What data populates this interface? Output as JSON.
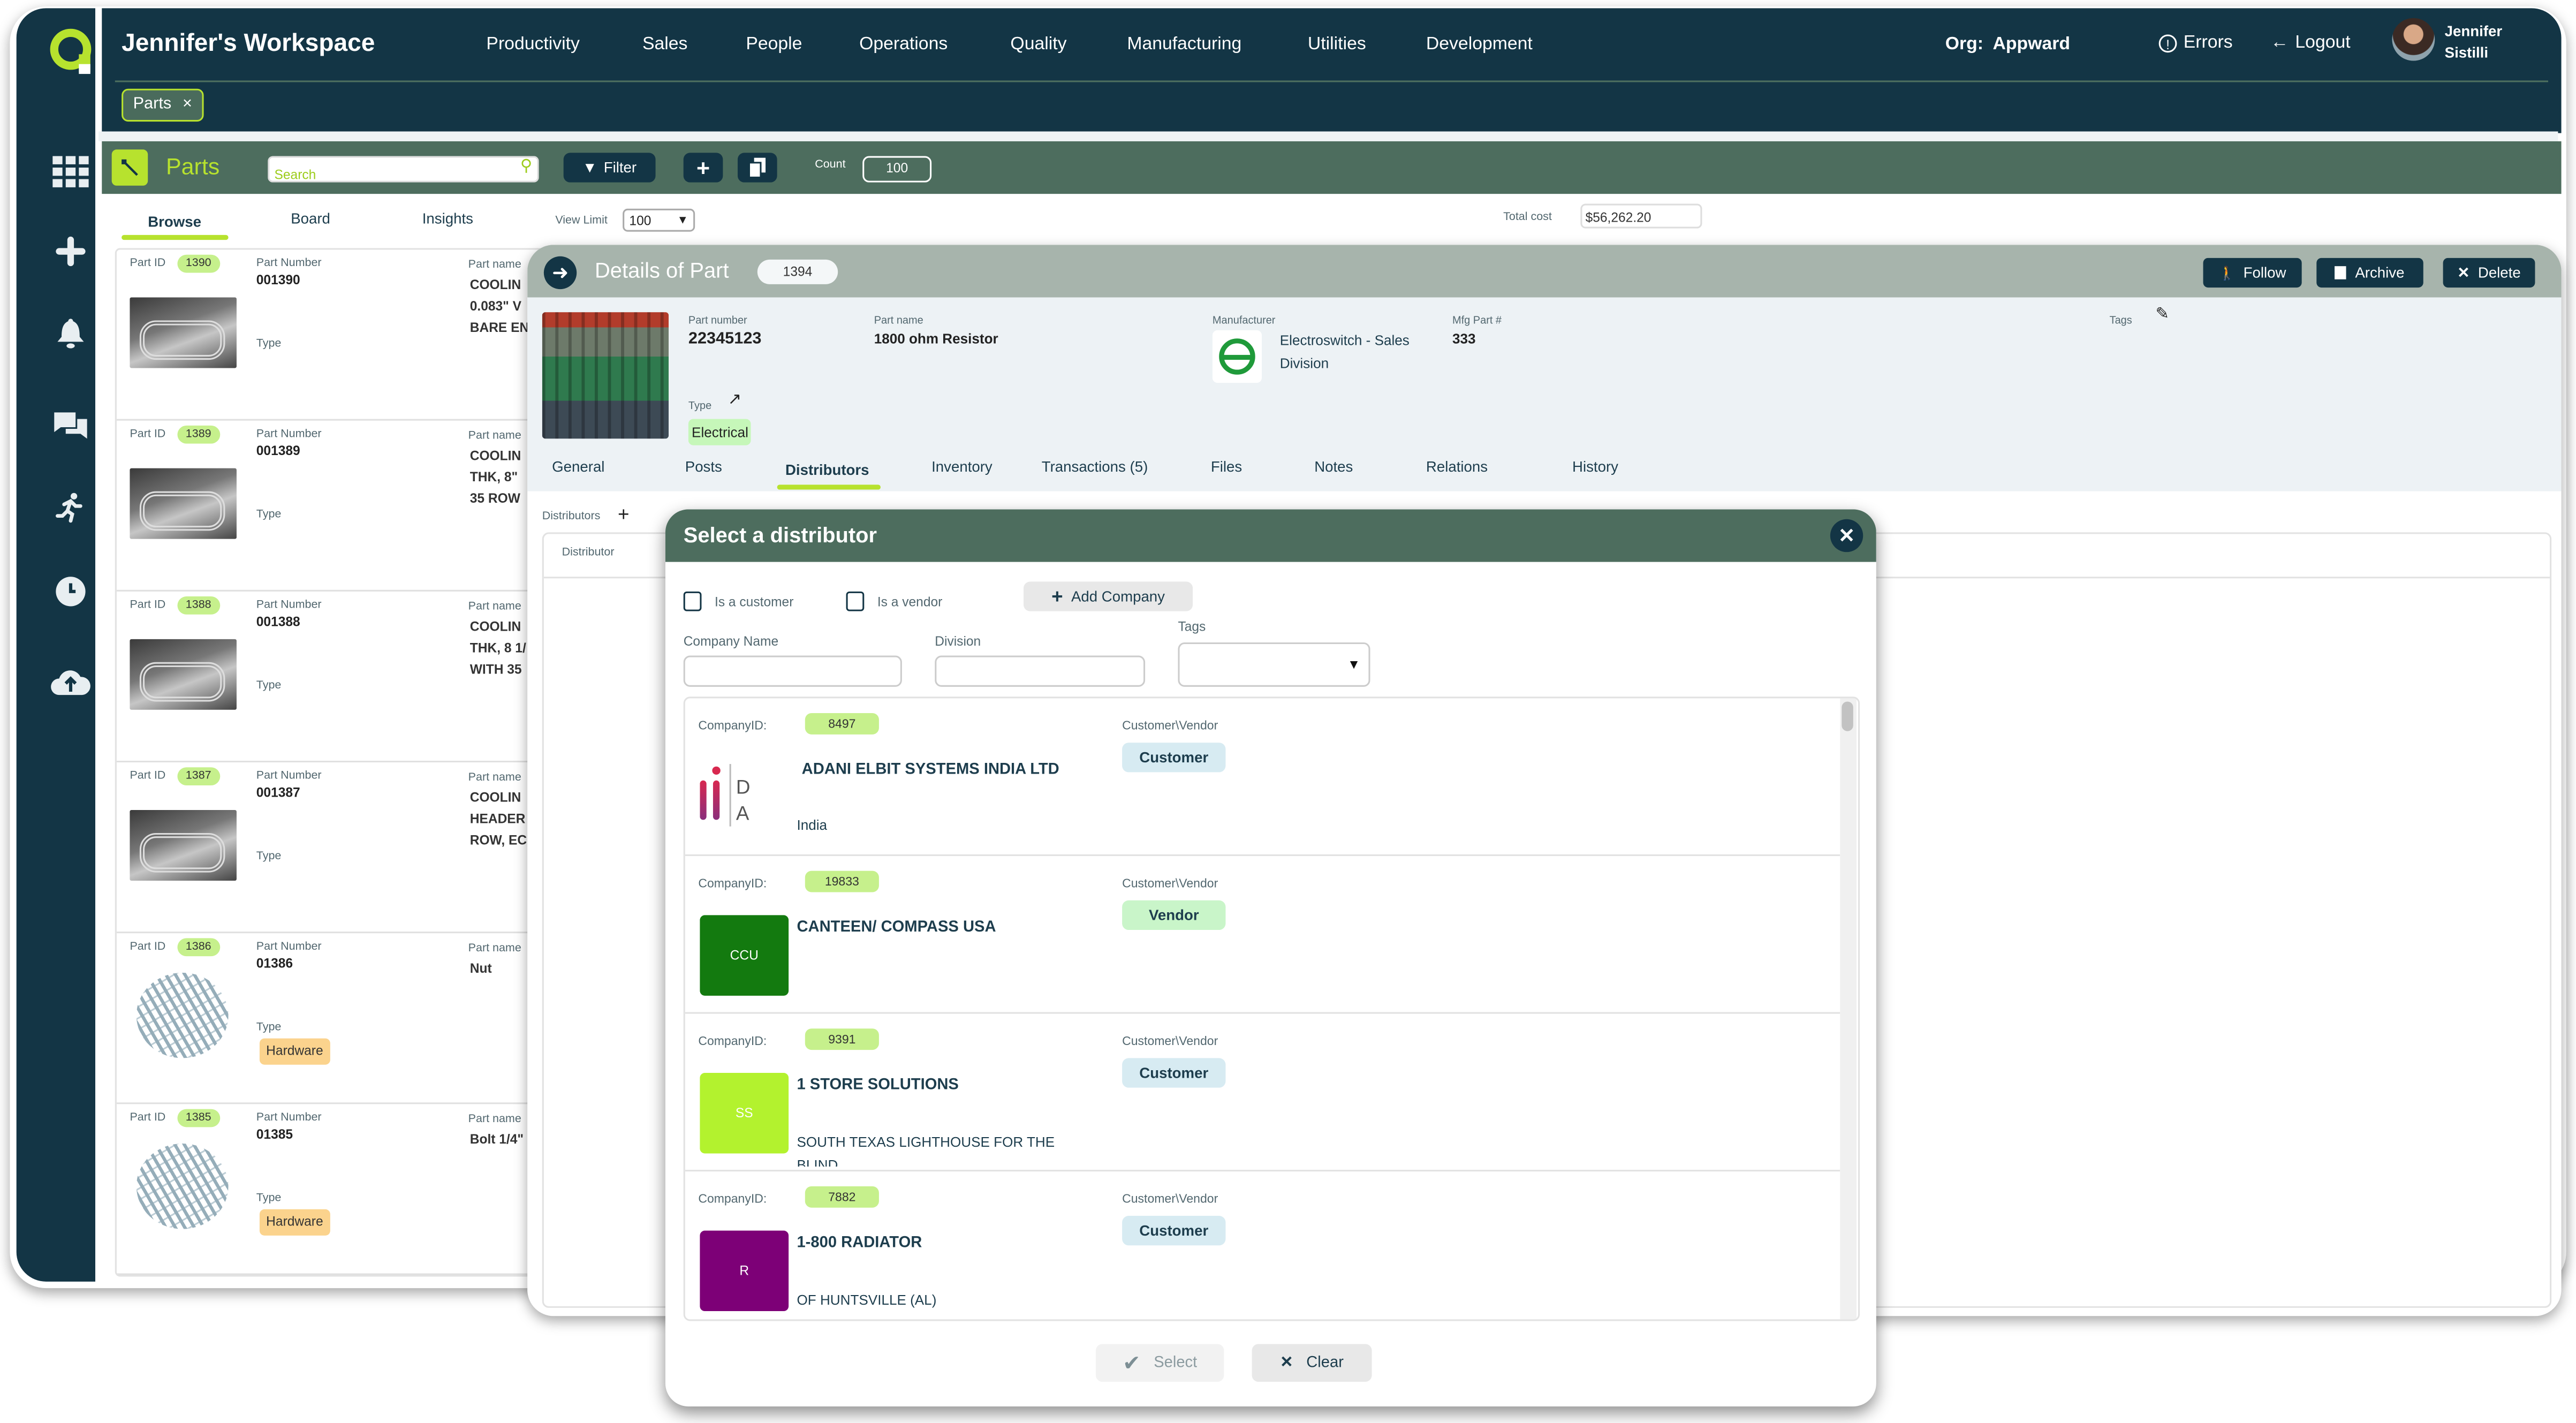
{
  "app": {
    "workspace_title": "Jennifer's Workspace",
    "nav": [
      "Productivity",
      "Sales",
      "People",
      "Operations",
      "Quality",
      "Manufacturing",
      "Utilities",
      "Development"
    ],
    "org_label": "Org:",
    "org_name": "Appward",
    "errors_label": "Errors",
    "logout_label": "Logout",
    "user_first": "Jennifer",
    "user_last": "Sistilli",
    "open_tab": "Parts",
    "open_tab_close": "×",
    "colors": {
      "navy": "#133545",
      "green_bar": "#4d6d5e",
      "accent": "#b7e22e"
    }
  },
  "sidebar": {
    "icons": [
      "apps-grid-icon",
      "plus-icon",
      "bell-icon",
      "chat-icon",
      "running-icon",
      "clock-icon",
      "cloud-upload-icon"
    ]
  },
  "parts_bar": {
    "title": "Parts",
    "search_placeholder": "Search",
    "filter_label": "Filter",
    "count_label": "Count",
    "count_value": "100"
  },
  "list": {
    "tabs": [
      "Browse",
      "Board",
      "Insights"
    ],
    "active_tab": "Browse",
    "view_limit_label": "View Limit",
    "view_limit_value": "100",
    "total_cost_label": "Total cost",
    "total_cost_value": "$56,262.20",
    "labels": {
      "part_id": "Part ID",
      "part_number": "Part Number",
      "part_name": "Part name",
      "type": "Type"
    },
    "rows": [
      {
        "id": "1390",
        "number": "001390",
        "name": [
          "COOLIN",
          "0.083\" V",
          "BARE EN"
        ],
        "type": "",
        "thumb": "coil"
      },
      {
        "id": "1389",
        "number": "001389",
        "name": [
          "COOLIN",
          "THK, 8\"",
          "35 ROW"
        ],
        "type": "",
        "thumb": "coil"
      },
      {
        "id": "1388",
        "number": "001388",
        "name": [
          "COOLIN",
          "THK, 8 1/",
          "WITH 35"
        ],
        "type": "",
        "thumb": "coil"
      },
      {
        "id": "1387",
        "number": "001387",
        "name": [
          "COOLIN",
          "HEADER",
          "ROW, EC"
        ],
        "type": "",
        "thumb": "coil"
      },
      {
        "id": "1386",
        "number": "01386",
        "name": [
          "Nut"
        ],
        "type": "Hardware",
        "thumb": "bolts"
      },
      {
        "id": "1385",
        "number": "01385",
        "name": [
          "Bolt 1/4\""
        ],
        "type": "Hardware",
        "thumb": "bolts"
      }
    ]
  },
  "details": {
    "title": "Details of Part",
    "part_id": "1394",
    "buttons": {
      "follow": "Follow",
      "archive": "Archive",
      "delete": "Delete"
    },
    "part_number_label": "Part number",
    "part_number": "22345123",
    "part_name_label": "Part name",
    "part_name": "1800 ohm Resistor",
    "manufacturer_label": "Manufacturer",
    "manufacturer_line1": "Electroswitch - Sales",
    "manufacturer_line2": "Division",
    "mfg_part_label": "Mfg Part #",
    "mfg_part": "333",
    "tags_label": "Tags",
    "type_label": "Type",
    "type_value": "Electrical",
    "tabs": [
      "General",
      "Posts",
      "Distributors",
      "Inventory",
      "Transactions (5)",
      "Files",
      "Notes",
      "Relations",
      "History"
    ],
    "active_tab": "Distributors",
    "distributors_label": "Distributors",
    "distributor_col": "Distributor"
  },
  "modal": {
    "title": "Select a distributor",
    "is_customer_label": "Is a customer",
    "is_vendor_label": "Is a vendor",
    "is_customer_checked": false,
    "is_vendor_checked": false,
    "add_company_label": "Add Company",
    "company_name_label": "Company Name",
    "company_name_value": "",
    "division_label": "Division",
    "division_value": "",
    "tags_label": "Tags",
    "tags_value": "",
    "company_id_label": "CompanyID:",
    "cv_label": "Customer\\Vendor",
    "companies": [
      {
        "id": "8497",
        "name": "ADANI ELBIT SYSTEMS INDIA LTD",
        "sub": "India",
        "role": "Customer",
        "logo_text": "",
        "logo_color": "#ffffff"
      },
      {
        "id": "19833",
        "name": "CANTEEN/ COMPASS USA",
        "sub": "",
        "role": "Vendor",
        "logo_text": "CCU",
        "logo_color": "#137a0f"
      },
      {
        "id": "9391",
        "name": "1 STORE SOLUTIONS",
        "sub": "SOUTH TEXAS LIGHTHOUSE FOR THE BLIND",
        "role": "Customer",
        "logo_text": "SS",
        "logo_color": "#b3f22e"
      },
      {
        "id": "7882",
        "name": "1-800 RADIATOR",
        "sub": "OF HUNTSVILLE (AL)",
        "role": "Customer",
        "logo_text": "R",
        "logo_color": "#7d0077"
      }
    ],
    "role_colors": {
      "Customer": "#d7ebf2",
      "Vendor": "#c9f5c9"
    },
    "select_label": "Select",
    "clear_label": "Clear"
  }
}
